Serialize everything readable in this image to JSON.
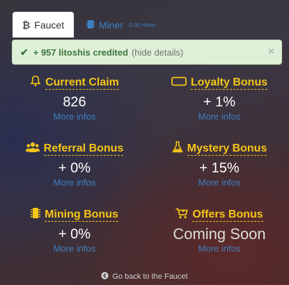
{
  "tabs": {
    "faucet_label": "Faucet",
    "miner_label": "Miner",
    "miner_rate": "0.00 H/min"
  },
  "alert": {
    "message": "+ 957 litoshis credited",
    "hide_details": "(hide details)",
    "close": "×"
  },
  "cells": [
    {
      "title": "Current Claim",
      "value": "826",
      "more": "More infos",
      "icon": "bell-icon"
    },
    {
      "title": "Loyalty Bonus",
      "value": "+ 1%",
      "more": "More infos",
      "icon": "ticket-icon"
    },
    {
      "title": "Referral Bonus",
      "value": "+ 0%",
      "more": "More infos",
      "icon": "users-icon"
    },
    {
      "title": "Mystery Bonus",
      "value": "+ 15%",
      "more": "More infos",
      "icon": "flask-icon"
    },
    {
      "title": "Mining Bonus",
      "value": "+ 0%",
      "more": "More infos",
      "icon": "chip-icon"
    },
    {
      "title": "Offers Bonus",
      "value": "Coming Soon",
      "more": "More infos",
      "icon": "cart-icon"
    }
  ],
  "footer": {
    "back_label": "Go back to the Faucet"
  },
  "colors": {
    "accent": "#f5c517",
    "link": "#3f7fc1",
    "success_bg": "#dff0d8",
    "success_text": "#3c763d"
  }
}
